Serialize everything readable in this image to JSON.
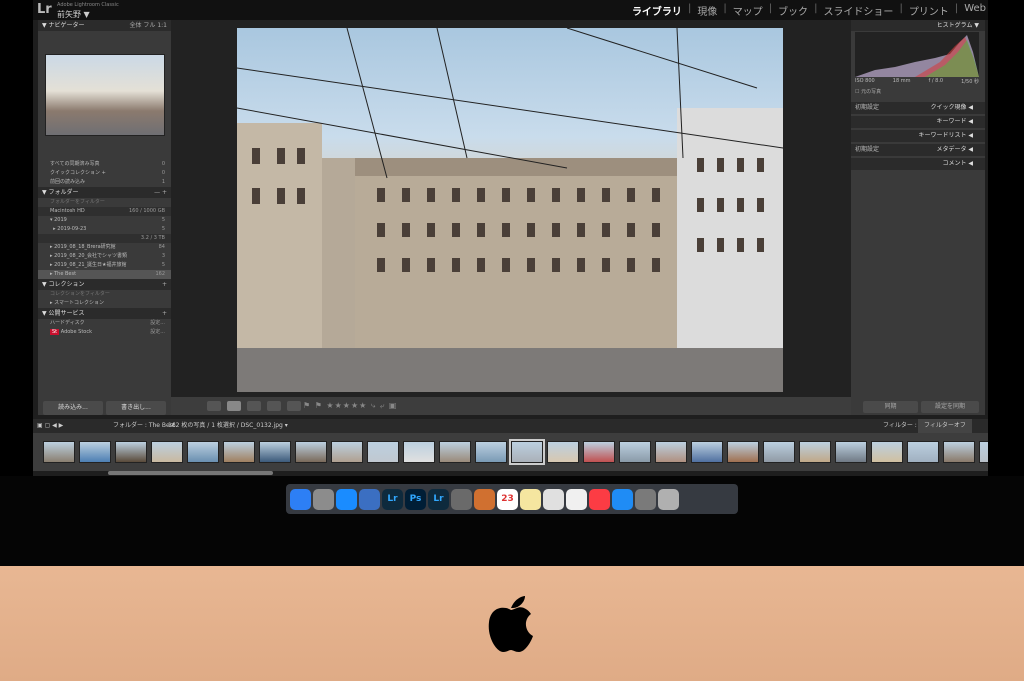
{
  "app": {
    "logo": "Lr",
    "subtitle": "Adobe Lightroom Classic",
    "catalog": "前矢野 ▼"
  },
  "modules": [
    "ライブラリ",
    "現像",
    "マップ",
    "ブック",
    "スライドショー",
    "プリント",
    "Web"
  ],
  "navigator": {
    "title": "ナビゲーター",
    "zoom_options": [
      "全体",
      "フル",
      "1:1"
    ]
  },
  "catalog_rows": [
    {
      "label": "すべての同期済み写真",
      "count": "0"
    },
    {
      "label": "クイックコレクション +",
      "count": "0"
    },
    {
      "label": "前回の読み込み",
      "count": "1"
    }
  ],
  "folders": {
    "title": "フォルダー",
    "search_placeholder": "フォルダーをフィルター",
    "volume": "Macintosh HD",
    "volume_info": "160 / 1000 GB",
    "items": [
      {
        "label": "2019",
        "count": "5"
      },
      {
        "label": "2019-09-23",
        "count": "5"
      }
    ],
    "volume2_info": "3.2 / 3 TB",
    "items2": [
      {
        "label": "2019_08_18_Brera研究館",
        "count": "84"
      },
      {
        "label": "2019_08_20_会社でシャツ書類",
        "count": "3"
      },
      {
        "label": "2019_08_21_誕生日★福井旅館",
        "count": "5"
      },
      {
        "label": "The Best",
        "count": "162"
      }
    ]
  },
  "collections": {
    "title": "コレクション",
    "search_placeholder": "コレクションをフィルター",
    "smart": "スマートコレクション"
  },
  "publish": {
    "title": "公開サービス",
    "items": [
      "ハードディスク",
      "Adobe Stock"
    ],
    "setup": "設定..."
  },
  "left_buttons": {
    "import": "読み込み...",
    "export": "書き出し..."
  },
  "histogram": {
    "title": "ヒストグラム",
    "iso": "ISO 800",
    "focal": "18 mm",
    "fstop": "f / 8.0",
    "shutter": "1/50 秒",
    "original": "元の写真"
  },
  "right_panels": [
    {
      "left": "初期設定",
      "right": "クイック現像"
    },
    {
      "left": "",
      "right": "キーワード"
    },
    {
      "left": "",
      "right": "キーワードリスト"
    },
    {
      "left": "初期設定",
      "right": "メタデータ"
    },
    {
      "left": "",
      "right": "コメント"
    }
  ],
  "right_buttons": {
    "sync": "同期",
    "sync_settings": "設定を同期"
  },
  "filmstrip": {
    "path": "フォルダー : The Best",
    "count": "162 枚の写真 / 1 枚選択 / DSC_0132.jpg ▾",
    "filter_label": "フィルター :",
    "filter_value": "フィルターオフ"
  },
  "thumb_colors": [
    "#8a7f70",
    "#4d7fb3",
    "#5a4a3a",
    "#c9b9a0",
    "#6a8fb0",
    "#a08060",
    "#3c5a7a",
    "#7a6a5a",
    "#b0a090",
    "#c0c8d0",
    "#e0e0e0",
    "#9a8a7a",
    "#7a9ab5",
    "#aab0b8",
    "#d8c8b0",
    "#c05050",
    "#8a9aa8",
    "#b09080",
    "#5070a0",
    "#a07050",
    "#909aa5",
    "#c0a888",
    "#707a85",
    "#d0c0a0",
    "#a0b0c0",
    "#8a7a6a",
    "#b8c0c8"
  ],
  "dock_icons": [
    {
      "name": "finder",
      "label": "",
      "color": "#2d7ff5"
    },
    {
      "name": "launchpad",
      "label": "",
      "color": "#8c8c8c"
    },
    {
      "name": "safari",
      "label": "",
      "color": "#1a8cff"
    },
    {
      "name": "preview",
      "label": "",
      "color": "#3b6fc2"
    },
    {
      "name": "lightroom",
      "label": "Lr",
      "color": "#0e2a3d"
    },
    {
      "name": "photoshop",
      "label": "Ps",
      "color": "#001e36"
    },
    {
      "name": "lightroom-classic",
      "label": "Lr",
      "color": "#0e2a3d"
    },
    {
      "name": "system",
      "label": "",
      "color": "#6a6a6a"
    },
    {
      "name": "photos-edit",
      "label": "",
      "color": "#d07030"
    },
    {
      "name": "calendar",
      "label": "23",
      "color": "#ffffff"
    },
    {
      "name": "notes",
      "label": "",
      "color": "#f5e6a0"
    },
    {
      "name": "preview2",
      "label": "",
      "color": "#e0e0e0"
    },
    {
      "name": "photos",
      "label": "",
      "color": "#f0f0f0"
    },
    {
      "name": "music",
      "label": "",
      "color": "#fc3c44"
    },
    {
      "name": "app-store",
      "label": "",
      "color": "#1f8cf5"
    },
    {
      "name": "system-preferences",
      "label": "",
      "color": "#7a7a7a"
    },
    {
      "name": "trash",
      "label": "",
      "color": "#b0b0b0"
    }
  ]
}
